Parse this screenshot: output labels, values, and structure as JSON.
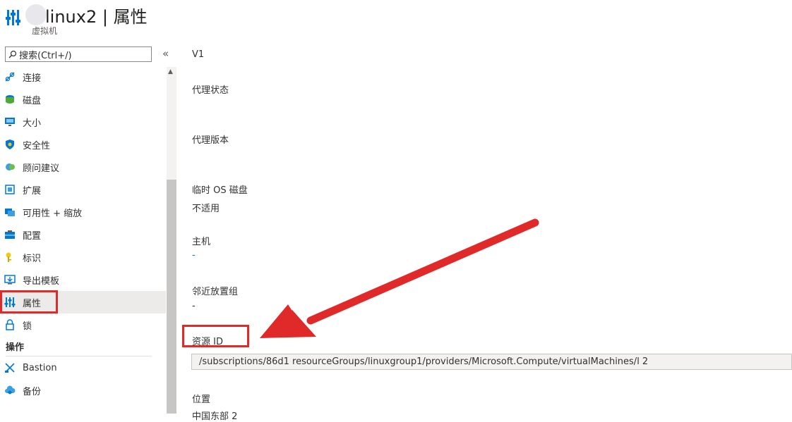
{
  "header": {
    "title": "linux2 | 属性",
    "subtitle": "虚拟机",
    "icon": "properties-icon"
  },
  "search": {
    "placeholder": "搜索(Ctrl+/)",
    "collapse_glyph": "«"
  },
  "sidebar": {
    "items": [
      {
        "label": "连接",
        "icon": "connect-icon"
      },
      {
        "label": "磁盘",
        "icon": "disk-icon"
      },
      {
        "label": "大小",
        "icon": "size-icon"
      },
      {
        "label": "安全性",
        "icon": "security-shield-icon"
      },
      {
        "label": "顾问建议",
        "icon": "advisor-icon"
      },
      {
        "label": "扩展",
        "icon": "extensions-icon"
      },
      {
        "label": "可用性 + 缩放",
        "icon": "availability-icon"
      },
      {
        "label": "配置",
        "icon": "configuration-icon"
      },
      {
        "label": "标识",
        "icon": "identity-key-icon"
      },
      {
        "label": "导出模板",
        "icon": "export-template-icon"
      },
      {
        "label": "属性",
        "icon": "properties-icon",
        "active": true
      },
      {
        "label": "锁",
        "icon": "lock-icon"
      }
    ],
    "section_label": "操作",
    "section_items": [
      {
        "label": "Bastion",
        "icon": "bastion-icon"
      },
      {
        "label": "备份",
        "icon": "backup-cloud-icon"
      }
    ]
  },
  "properties": {
    "generation_value": "V1",
    "agent_status_label": "代理状态",
    "agent_version_label": "代理版本",
    "temp_os_disk_label": "临时 OS 磁盘",
    "temp_os_disk_value": "不适用",
    "host_label": "主机",
    "host_value": "-",
    "ppg_label": "邻近放置组",
    "ppg_value": "-",
    "resource_id_label": "资源 ID",
    "resource_id_value": "/subscriptions/86d1     resourceGroups/linuxgroup1/providers/Microsoft.Compute/virtualMachines/l     2",
    "location_label": "位置",
    "location_value": "中国东部 2"
  },
  "colors": {
    "highlight": "#e02a2a",
    "accent": "#0078d4"
  }
}
